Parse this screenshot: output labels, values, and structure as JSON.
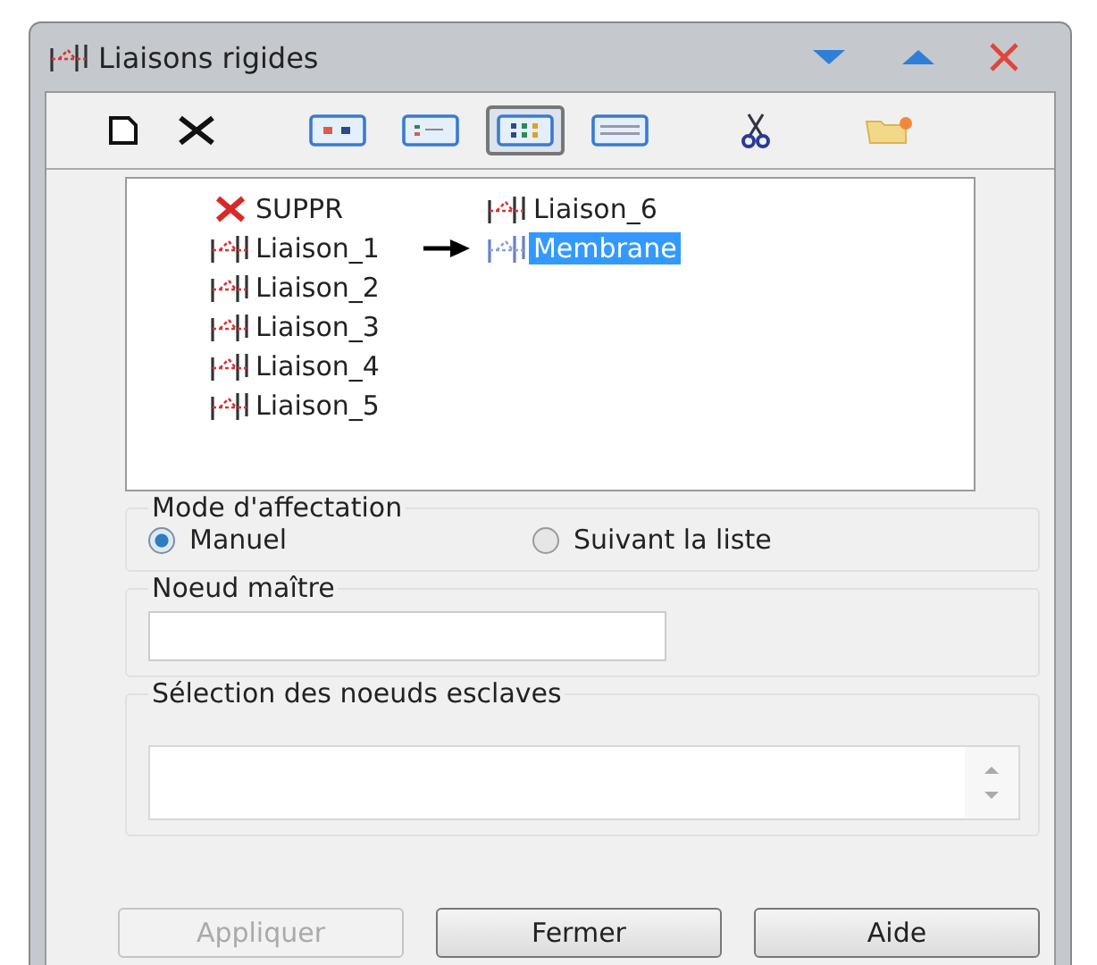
{
  "window": {
    "title": "Liaisons rigides"
  },
  "toolbar": [
    {
      "kind": "new",
      "selected": false
    },
    {
      "kind": "delete",
      "selected": false
    },
    {
      "kind": "view-large",
      "selected": false
    },
    {
      "kind": "view-small",
      "selected": false
    },
    {
      "kind": "view-list",
      "selected": true
    },
    {
      "kind": "view-details",
      "selected": false
    },
    {
      "kind": "cut",
      "selected": false
    },
    {
      "kind": "folder",
      "selected": false
    }
  ],
  "list": [
    {
      "label": "SUPPR",
      "kind": "delete",
      "selected": false,
      "pointed": false
    },
    {
      "label": "Liaison_1",
      "kind": "link",
      "selected": false,
      "pointed": false
    },
    {
      "label": "Liaison_2",
      "kind": "link",
      "selected": false,
      "pointed": false
    },
    {
      "label": "Liaison_3",
      "kind": "link",
      "selected": false,
      "pointed": false
    },
    {
      "label": "Liaison_4",
      "kind": "link",
      "selected": false,
      "pointed": false
    },
    {
      "label": "Liaison_5",
      "kind": "link",
      "selected": false,
      "pointed": false
    },
    {
      "label": "Liaison_6",
      "kind": "link",
      "selected": false,
      "pointed": false
    },
    {
      "label": "Membrane",
      "kind": "link",
      "selected": true,
      "pointed": true
    }
  ],
  "mode": {
    "legend": "Mode d'affectation",
    "options": [
      {
        "label": "Manuel",
        "selected": true
      },
      {
        "label": "Suivant la liste",
        "selected": false
      }
    ]
  },
  "master": {
    "legend": "Noeud maître"
  },
  "slaves": {
    "legend": "Sélection des noeuds esclaves"
  },
  "buttons": [
    {
      "label": "Appliquer",
      "disabled": true
    },
    {
      "label": "Fermer",
      "disabled": false
    },
    {
      "label": "Aide",
      "disabled": false
    }
  ]
}
